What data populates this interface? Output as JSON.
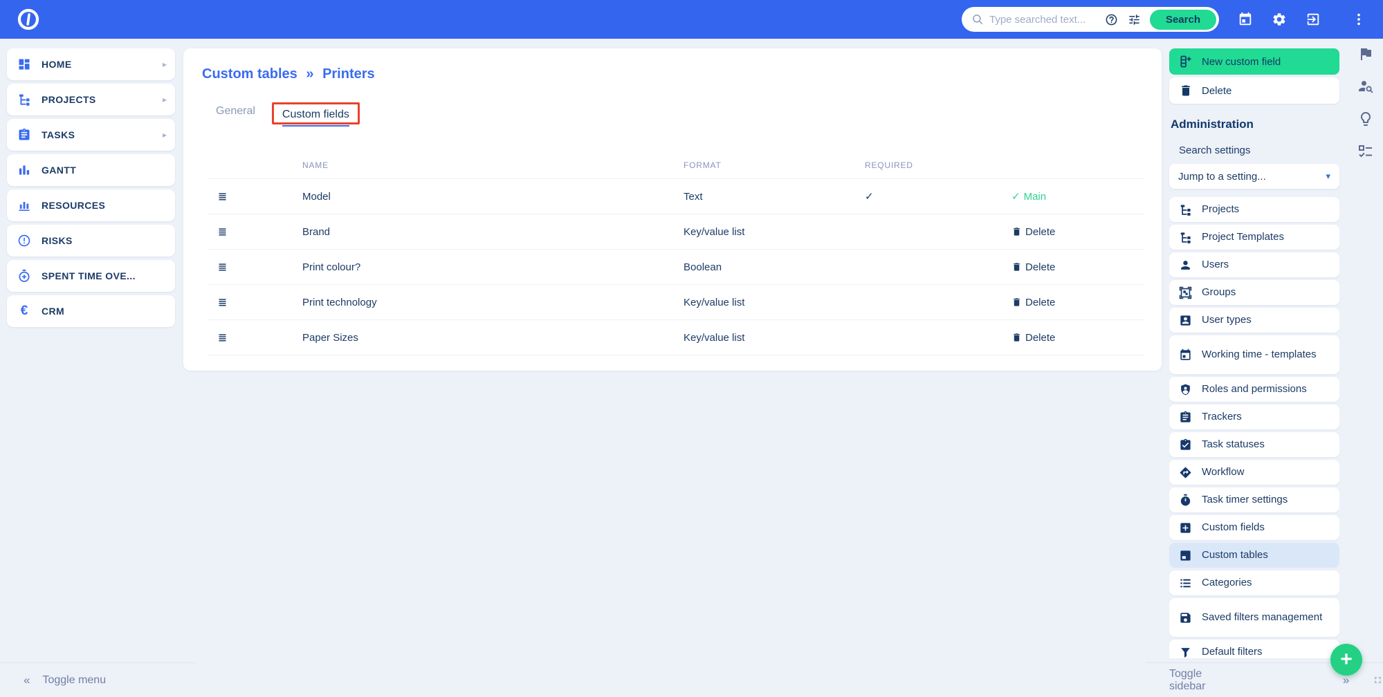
{
  "glyphs": {
    "breadcrumb_separator": "»",
    "collapse_left": "«",
    "expand_right": "»",
    "caret_down": "▾",
    "submenu_arrow": "▸",
    "check": "✓",
    "plus": "+",
    "euro": "€"
  },
  "colors": {
    "topbar_blue": "#3465ee",
    "accent_blue": "#3a6cf0",
    "navy": "#1c3b66",
    "button_green": "#21da93",
    "main_green": "#2fd292",
    "annotation_red": "#e8432c",
    "page_bg": "#edf1f8",
    "active_item_bg": "#d9e7f9"
  },
  "topbar": {
    "search_placeholder": "Type searched text...",
    "search_button": "Search"
  },
  "left_menu": {
    "toggle_label": "Toggle menu",
    "items": [
      {
        "label": "HOME",
        "icon": "dashboard-grid",
        "has_submenu": true
      },
      {
        "label": "PROJECTS",
        "icon": "project-tree",
        "has_submenu": true
      },
      {
        "label": "TASKS",
        "icon": "clipboard",
        "has_submenu": true
      },
      {
        "label": "GANTT",
        "icon": "gantt-bars",
        "has_submenu": false
      },
      {
        "label": "RESOURCES",
        "icon": "bar-chart",
        "has_submenu": false
      },
      {
        "label": "RISKS",
        "icon": "alert-circle",
        "has_submenu": false
      },
      {
        "label": "SPENT TIME OVE...",
        "icon": "stopwatch-plus",
        "has_submenu": false
      },
      {
        "label": "CRM",
        "icon": "euro",
        "has_submenu": false
      }
    ]
  },
  "content": {
    "breadcrumb": {
      "section": "Custom tables",
      "page": "Printers"
    },
    "tabs": [
      {
        "label": "General",
        "active": false
      },
      {
        "label": "Custom fields",
        "active": true,
        "annotated": true
      }
    ],
    "table": {
      "columns": {
        "name": "NAME",
        "format": "FORMAT",
        "required": "REQUIRED"
      },
      "rows": [
        {
          "name": "Model",
          "format": "Text",
          "required": "✓",
          "action": "Main",
          "action_type": "main"
        },
        {
          "name": "Brand",
          "format": "Key/value list",
          "required": "",
          "action": "Delete",
          "action_type": "delete"
        },
        {
          "name": "Print colour?",
          "format": "Boolean",
          "required": "",
          "action": "Delete",
          "action_type": "delete"
        },
        {
          "name": "Print technology",
          "format": "Key/value list",
          "required": "",
          "action": "Delete",
          "action_type": "delete"
        },
        {
          "name": "Paper Sizes",
          "format": "Key/value list",
          "required": "",
          "action": "Delete",
          "action_type": "delete"
        }
      ]
    }
  },
  "sidebar": {
    "new_button": "New custom field",
    "delete_button": "Delete",
    "heading": "Administration",
    "search_settings_label": "Search settings",
    "jump_select_value": "Jump to a setting...",
    "toggle_label": "Toggle sidebar",
    "active_item": "Custom tables",
    "items": [
      {
        "label": "Projects",
        "icon": "project-tree"
      },
      {
        "label": "Project Templates",
        "icon": "project-tree"
      },
      {
        "label": "Users",
        "icon": "person"
      },
      {
        "label": "Groups",
        "icon": "groups-frame"
      },
      {
        "label": "User types",
        "icon": "badge-card"
      },
      {
        "label": "Working time - templates",
        "icon": "calendar"
      },
      {
        "label": "Roles and permissions",
        "icon": "shield-person"
      },
      {
        "label": "Trackers",
        "icon": "clipboard"
      },
      {
        "label": "Task statuses",
        "icon": "clipboard-check"
      },
      {
        "label": "Workflow",
        "icon": "workflow-diamond"
      },
      {
        "label": "Task timer settings",
        "icon": "stopwatch"
      },
      {
        "label": "Custom fields",
        "icon": "add-box"
      },
      {
        "label": "Custom tables",
        "icon": "table"
      },
      {
        "label": "Categories",
        "icon": "list"
      },
      {
        "label": "Saved filters management",
        "icon": "save-disk"
      },
      {
        "label": "Default filters",
        "icon": "funnel"
      }
    ]
  }
}
